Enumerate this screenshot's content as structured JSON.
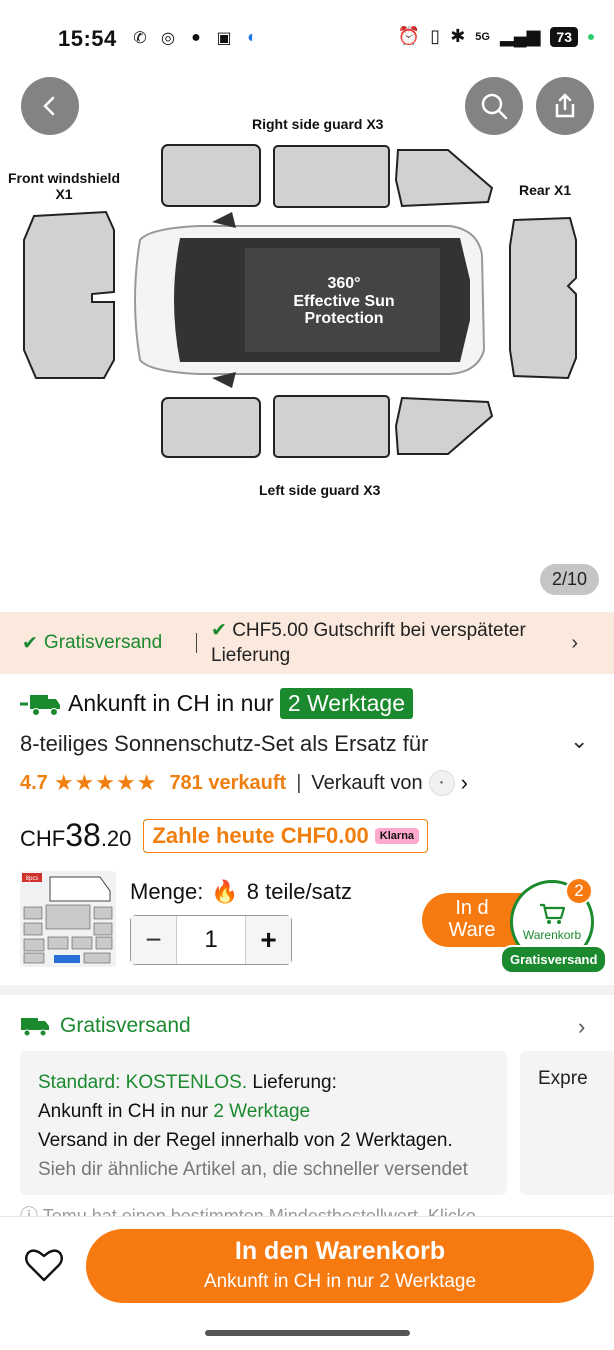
{
  "status_bar": {
    "time": "15:54",
    "battery": "73",
    "network": "5G"
  },
  "hero": {
    "label_top": "Right side guard X3",
    "label_front_1": "Front windshield",
    "label_front_2": "X1",
    "label_rear": "Rear X1",
    "label_bottom": "Left side guard X3",
    "center_1": "360°",
    "center_2": "Effective Sun",
    "center_3": "Protection",
    "pager": "2/10"
  },
  "promo": {
    "free_shipping": "Gratisversand",
    "credit": "CHF5.00 Gutschrift bei verspäteter Lieferung"
  },
  "product": {
    "arrival_prefix": "Ankunft in CH in nur",
    "arrival_badge": "2 Werktage",
    "title": "8-teiliges Sonnenschutz-Set als Ersatz für",
    "rating": "4.7",
    "stars": "★★★★★",
    "sold": "781 verkauft",
    "sold_by": "Verkauft von",
    "currency": "CHF",
    "price_main": "38",
    "price_cents": ".20",
    "pay_today": "Zahle heute CHF0.00",
    "klarna": "Klarna",
    "quantity_label": "Menge:",
    "quantity_unit": "8 teile/satz",
    "quantity": "1",
    "thumb_tag": "8pcs"
  },
  "floating": {
    "add_partial_1": "In d",
    "add_partial_2": "Ware",
    "cart_label": "Warenkorb",
    "cart_count": "2",
    "free_chip": "Gratisversand"
  },
  "shipping": {
    "title": "Gratisversand",
    "standard_label": "Standard: KOSTENLOS.",
    "delivery_word": "Lieferung:",
    "arrival_prefix": "Ankunft in CH in nur",
    "arrival_days": "2 Werktage",
    "usually": "Versand in der Regel innerhalb von 2 Werktagen.",
    "similar": "Sieh dir ähnliche Artikel an, die schneller versendet",
    "express_partial": "Expre",
    "notice": "Temu hat einen bestimmten Mindestbestellwert. Klicke"
  },
  "bottom": {
    "cta_main": "In den Warenkorb",
    "cta_sub": "Ankunft in CH in nur 2 Werktage"
  },
  "colors": {
    "accent_orange": "#f77a10",
    "green": "#1b8a2f",
    "promo_bg": "#fbe9dd"
  }
}
